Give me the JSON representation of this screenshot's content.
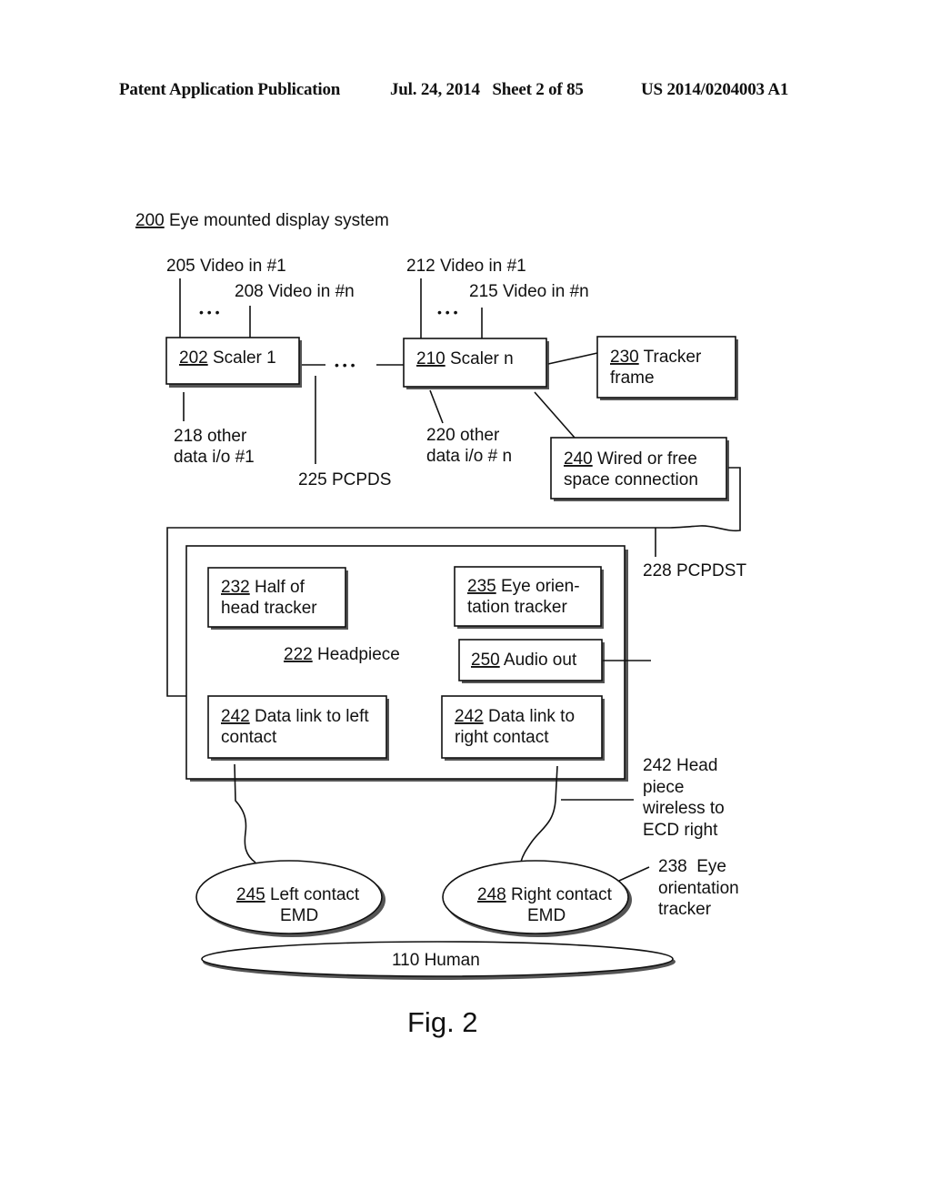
{
  "header": {
    "publication": "Patent Application Publication",
    "date_sheet": "Jul. 24, 2014   Sheet 2 of 85",
    "patent_number": "US 2014/0204003 A1"
  },
  "diagram": {
    "title": {
      "num": "200",
      "text": " Eye mounted display system"
    },
    "inputs": {
      "video_205": "205 Video in #1",
      "video_208": "208 Video in #n",
      "video_212": "212 Video in #1",
      "video_215": "215 Video in #n",
      "ellipsis": "• • •"
    },
    "scaler1": {
      "num": "202",
      "text": " Scaler 1"
    },
    "scalern": {
      "num": "210",
      "text": " Scaler n"
    },
    "tracker_frame": {
      "num": "230",
      "line1": " Tracker",
      "line2": "frame"
    },
    "wired": {
      "num": "240",
      "line1": " Wired or free",
      "line2": "space connection"
    },
    "labels": {
      "other218_l1": "218 other",
      "other218_l2": "data i/o #1",
      "pcpds": "225 PCPDS",
      "other220_l1": "220 other",
      "other220_l2": "data i/o # n",
      "pcpdst": "228 PCPDST",
      "bus_ellipsis": "• • •",
      "hp_wireless_l1": "242 Head",
      "hp_wireless_l2": "piece",
      "hp_wireless_l3": "wireless to",
      "hp_wireless_l4": "ECD right",
      "eye238_l1": "238  Eye",
      "eye238_l2": "orientation",
      "eye238_l3": "tracker"
    },
    "headpiece": {
      "num": "222",
      "text": " Headpiece"
    },
    "head_tracker": {
      "num": "232",
      "line1": " Half of",
      "line2": "head tracker"
    },
    "eye_orient": {
      "num": "235",
      "line1": " Eye orien-",
      "line2": "tation tracker"
    },
    "audio": {
      "num": "250",
      "text": " Audio out"
    },
    "link_left": {
      "num": "242",
      "line1": " Data link to left",
      "line2": "contact"
    },
    "link_right": {
      "num": "242",
      "line1": " Data link to",
      "line2": "right contact"
    },
    "left_emd": {
      "num": "245",
      "line1": " Left contact",
      "line2": "EMD"
    },
    "right_emd": {
      "num": "248",
      "line1": " Right contact",
      "line2": "EMD"
    },
    "human": "110 Human",
    "figure_label": "Fig. 2"
  }
}
